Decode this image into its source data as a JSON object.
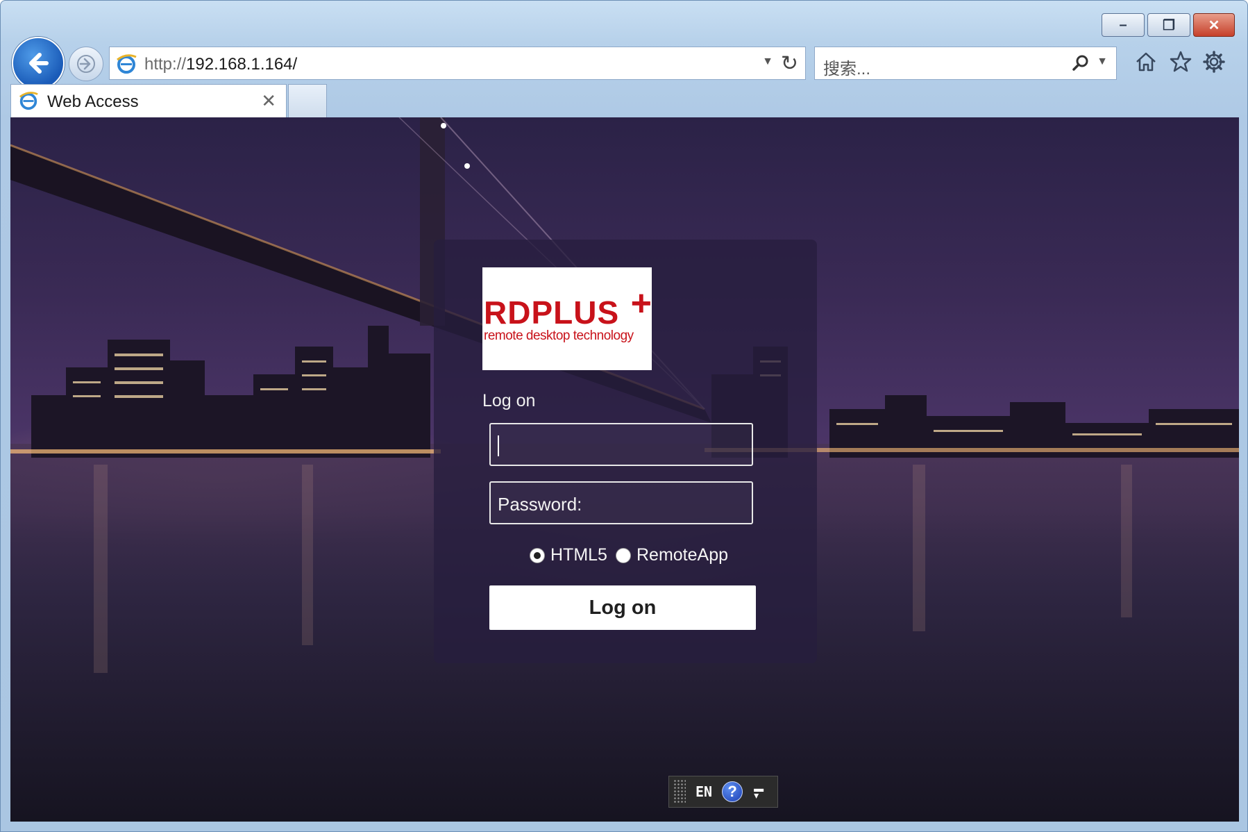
{
  "window": {
    "minimize_glyph": "–",
    "maximize_glyph": "❐",
    "close_glyph": "✕"
  },
  "browser": {
    "address": {
      "protocol": "http://",
      "host": "192.168.1.164/"
    },
    "search": {
      "placeholder": "搜索..."
    },
    "tab": {
      "title": "Web Access",
      "close_glyph": "✕"
    },
    "icons": [
      "back-icon",
      "forward-icon",
      "ie-icon",
      "dropdown-icon",
      "refresh-icon",
      "search-icon",
      "home-icon",
      "favorites-star-icon",
      "settings-gear-icon"
    ]
  },
  "login": {
    "logo": {
      "brand": "RDPLUS",
      "plus": "+",
      "tagline": "remote desktop technology"
    },
    "title": "Log on",
    "username": {
      "value": ""
    },
    "password": {
      "placeholder": "Password:"
    },
    "modes": [
      {
        "label": "HTML5",
        "checked": true
      },
      {
        "label": "RemoteApp",
        "checked": false
      }
    ],
    "submit_label": "Log on"
  },
  "langbar": {
    "language": "EN",
    "help": "?"
  },
  "colors": {
    "brand_red": "#c8121a",
    "panel": "#261e3e",
    "browser_chrome": "#b7d1ea"
  }
}
